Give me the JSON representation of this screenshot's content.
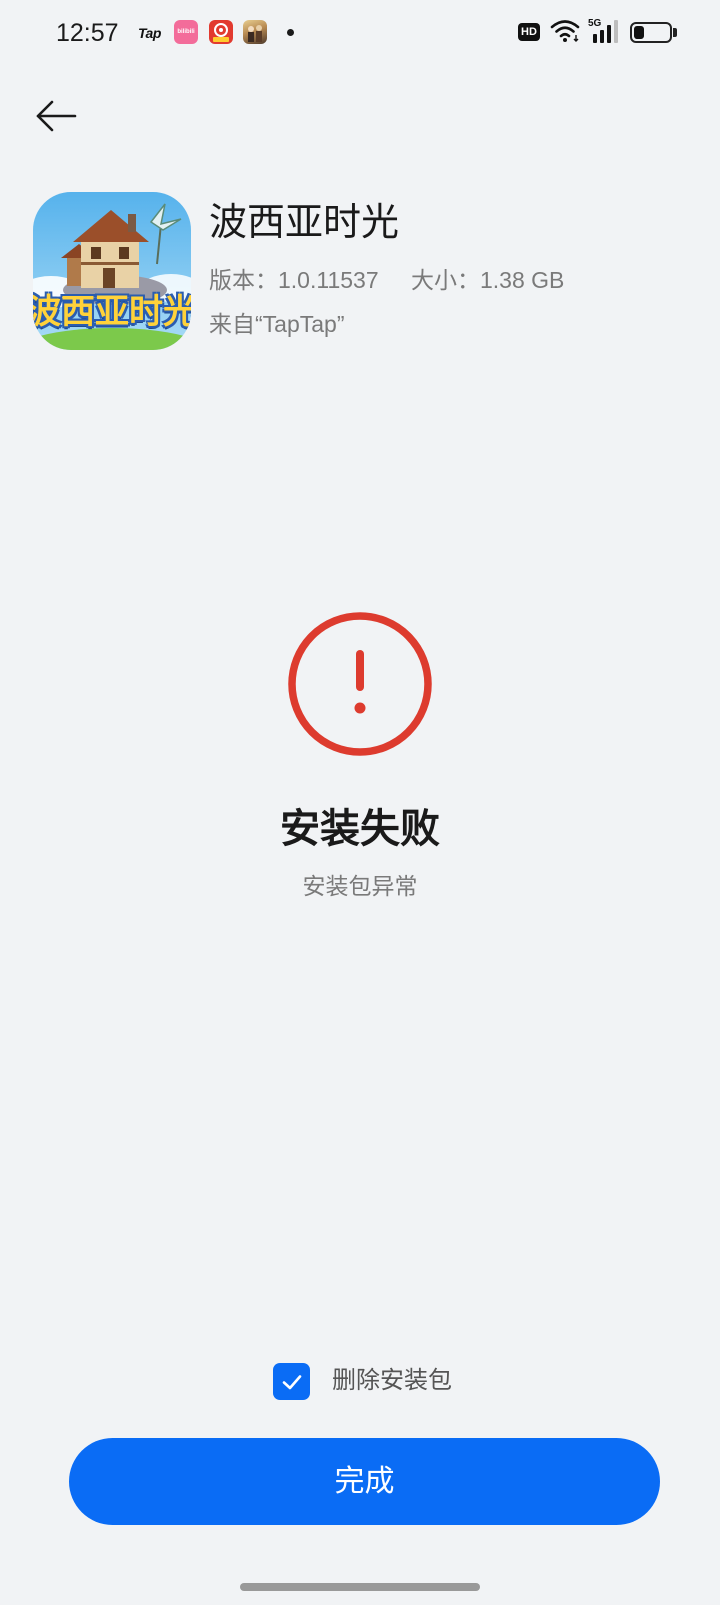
{
  "status_bar": {
    "time": "12:57",
    "notifications": [
      {
        "icon": "taptap-icon",
        "text": "Tap"
      },
      {
        "icon": "bilibili-icon",
        "text": "bilibili"
      },
      {
        "icon": "red-app-icon"
      },
      {
        "icon": "game-app-icon"
      },
      {
        "icon": "more-notifications-dot"
      }
    ],
    "hd_badge": "HD",
    "network": "5G",
    "wifi_icon": "wifi-icon",
    "battery_level": 0.3
  },
  "header": {
    "back_icon": "arrow-left-icon"
  },
  "app": {
    "name": "波西亚时光",
    "version": "版本：1.0.11537",
    "size": "大小：1.38 GB",
    "source": "来自“TapTap”",
    "icon_art_text": "波西亚时光"
  },
  "result": {
    "icon": "error-exclamation-icon",
    "title": "安装失败",
    "message": "安装包异常"
  },
  "options": {
    "delete_package_label": "删除安装包",
    "delete_package_checked": true
  },
  "actions": {
    "done_label": "完成"
  },
  "colors": {
    "background": "#f1f3f5",
    "accent": "#0a6cf5",
    "error": "#dd3b2e",
    "title_text": "#1a1a1a",
    "secondary_text": "#7a7a7a"
  }
}
